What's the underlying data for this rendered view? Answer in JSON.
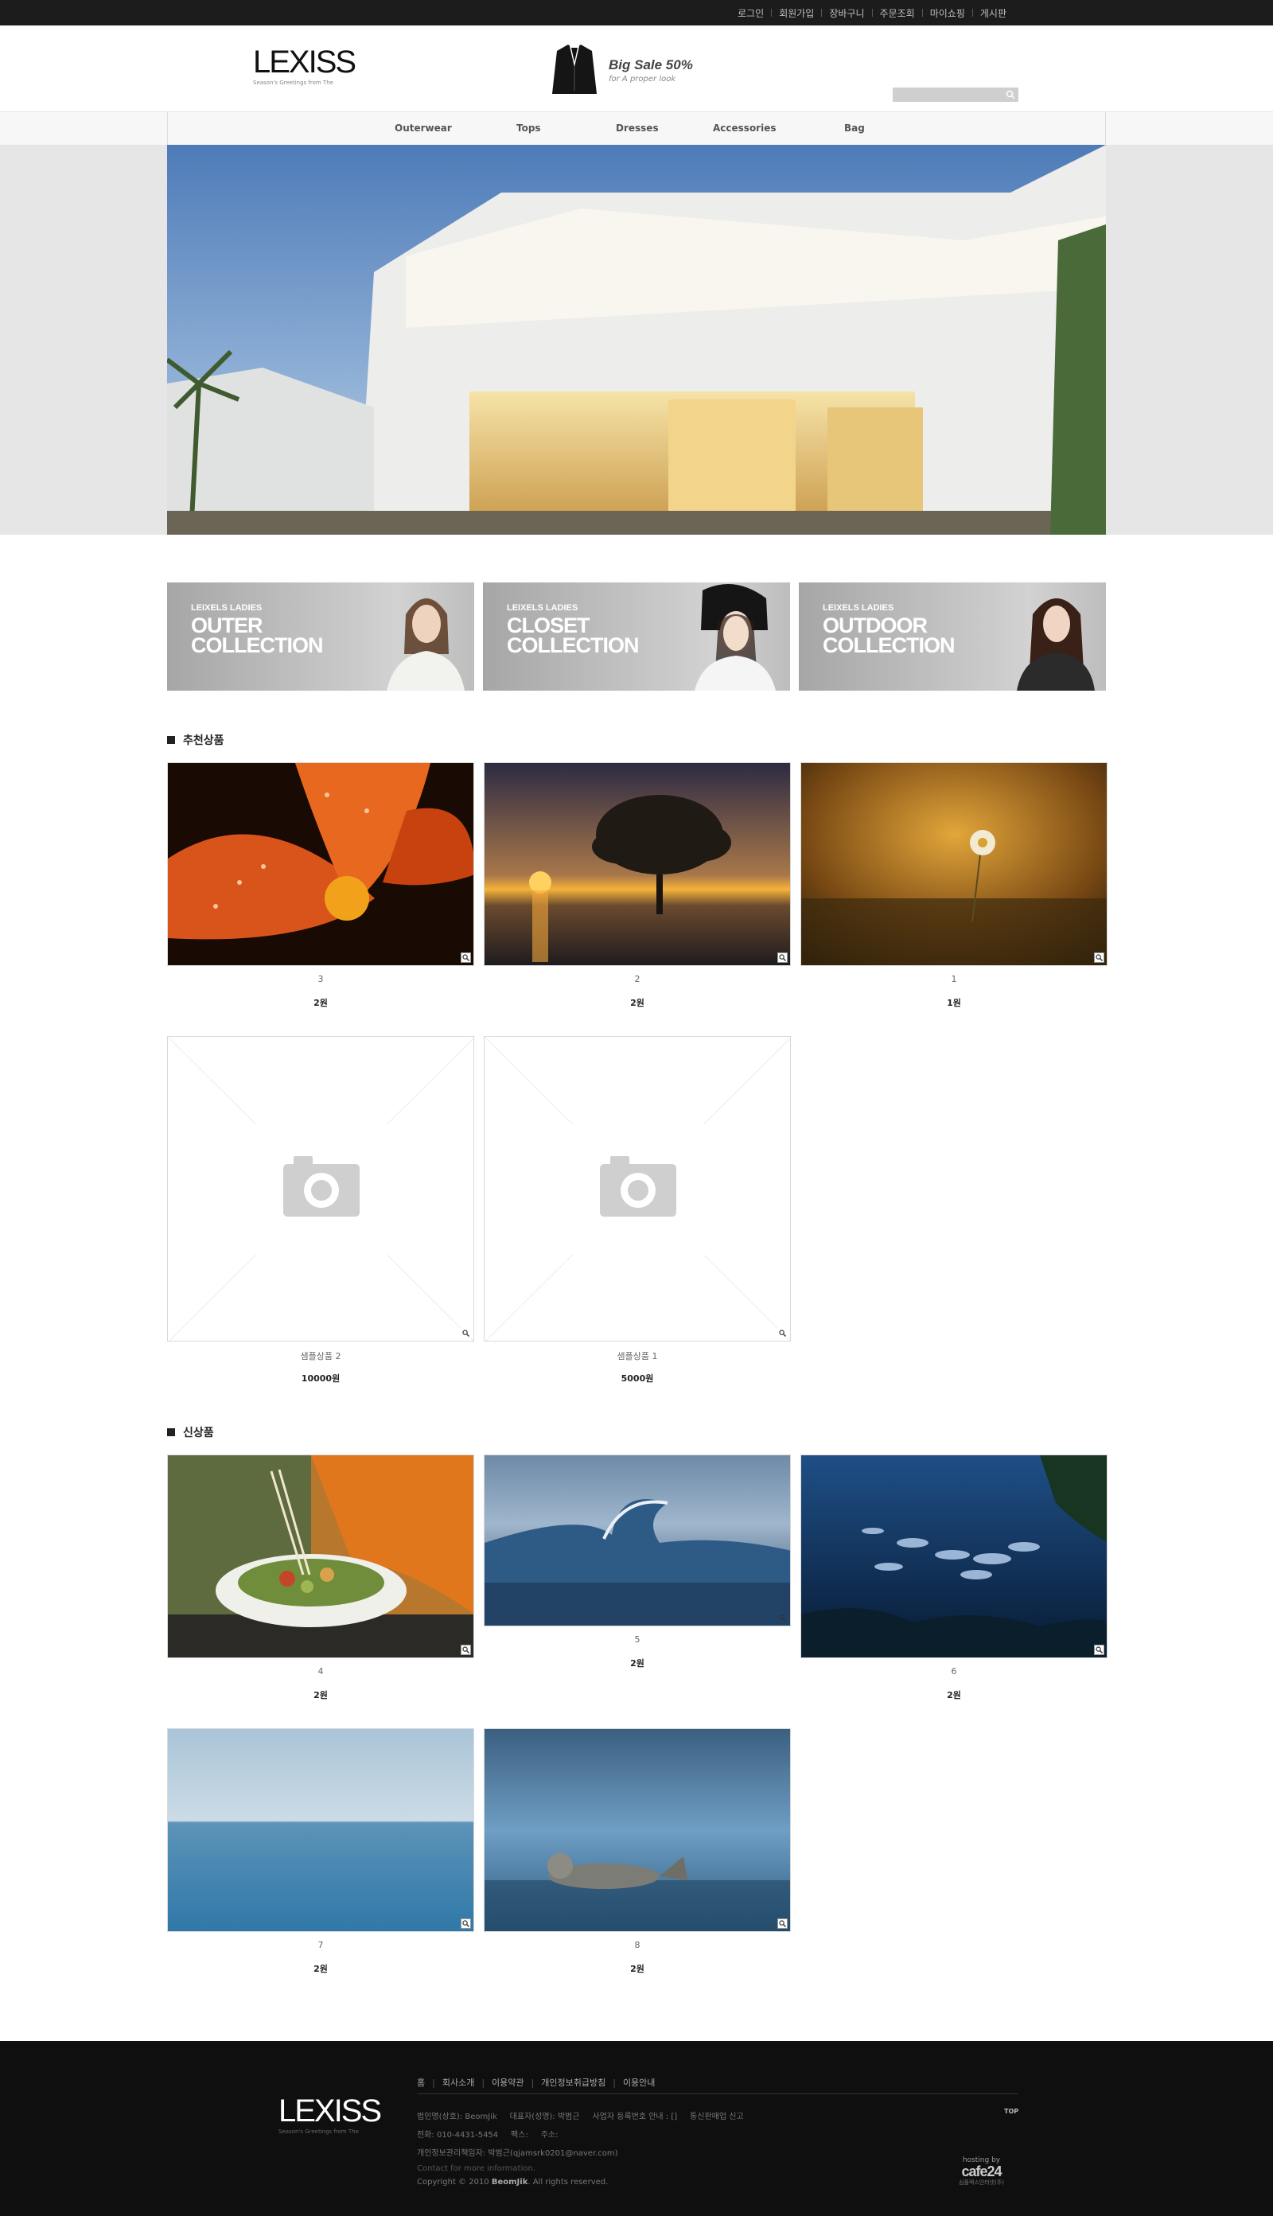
{
  "top_menu": [
    "로그인",
    "회원가입",
    "장바구니",
    "주문조회",
    "마이쇼핑",
    "게시판"
  ],
  "logo": {
    "text": "LEXISS",
    "sub": "Season's Greetings from The"
  },
  "promo": {
    "title": "Big Sale 50%",
    "sub": "for A proper look"
  },
  "search": {
    "placeholder": "",
    "icon": "search-icon"
  },
  "nav": [
    "Outerwear",
    "Tops",
    "Dresses",
    "Accessories",
    "Bag"
  ],
  "banners": [
    {
      "small": "LEIXELS LADIES",
      "big1": "OUTER",
      "big2": "COLLECTION"
    },
    {
      "small": "LEIXELS LADIES",
      "big1": "CLOSET",
      "big2": "COLLECTION"
    },
    {
      "small": "LEIXELS LADIES",
      "big1": "OUTDOOR",
      "big2": "COLLECTION"
    }
  ],
  "section1": {
    "title": "추천상품",
    "products": [
      {
        "name": "3",
        "price": "2원",
        "image": "orange lily with water droplets"
      },
      {
        "name": "2",
        "price": "2원",
        "image": "tree at sunset over water"
      },
      {
        "name": "1",
        "price": "1원",
        "image": "daisy in golden light"
      },
      {
        "name": "샘플상품 2",
        "price": "10000원",
        "image": "placeholder camera"
      },
      {
        "name": "샘플상품 1",
        "price": "5000원",
        "image": "placeholder camera"
      }
    ]
  },
  "section2": {
    "title": "신상품",
    "products": [
      {
        "name": "4",
        "price": "2원",
        "image": "salad bowl"
      },
      {
        "name": "5",
        "price": "2원",
        "image": "ocean wave"
      },
      {
        "name": "6",
        "price": "2원",
        "image": "fish underwater"
      },
      {
        "name": "7",
        "price": "2원",
        "image": "calm sea horizon"
      },
      {
        "name": "8",
        "price": "2원",
        "image": "seal on shore"
      }
    ]
  },
  "footer": {
    "menu": [
      "홈",
      "회사소개",
      "이용약관",
      "개인정보취급방침",
      "이용안내"
    ],
    "line1": "법인명(상호): BeomJik     대표자(성명): 박범근     사업자 등록번호 안내 : []     통신판매업 신고",
    "line2": "전화: 010-4431-5454     팩스:     주소:",
    "line3": "개인정보관리책임자: 박범근(qjamsrk0201@naver.com)",
    "line4": "Contact for more information.",
    "copyright_pre": "Copyright © 2010 ",
    "copyright_brand": "BeomJik",
    "copyright_post": ". All rights reserved.",
    "top": "TOP",
    "hosting1": "hosting by",
    "hosting2": "cafe24",
    "hosting3": "심플렉스인터넷(주)"
  }
}
